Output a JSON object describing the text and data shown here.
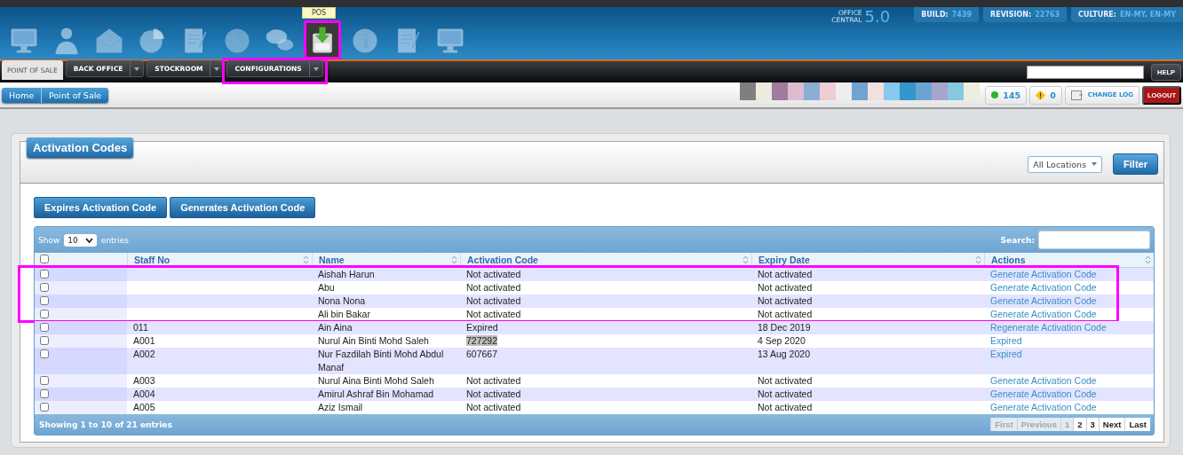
{
  "header": {
    "tooltip": "POS",
    "brand_lines": [
      "OFFICE",
      "CENTRAL"
    ],
    "version": "5.0",
    "info": [
      {
        "label": "BUILD:",
        "value": "7439"
      },
      {
        "label": "REVISION:",
        "value": "22763"
      },
      {
        "label": "CULTURE:",
        "value": "EN-MY, EN-MY"
      }
    ],
    "app_icons": [
      {
        "kind": "monitor",
        "selected": false
      },
      {
        "kind": "person",
        "selected": false
      },
      {
        "kind": "envelope",
        "selected": false
      },
      {
        "kind": "pie",
        "selected": false
      },
      {
        "kind": "document",
        "selected": false
      },
      {
        "kind": "phone",
        "selected": false
      },
      {
        "kind": "chat",
        "selected": false
      },
      {
        "kind": "pos",
        "selected": true,
        "highlighted": true
      },
      {
        "kind": "info",
        "selected": false
      },
      {
        "kind": "document",
        "selected": false
      },
      {
        "kind": "monitor",
        "selected": false
      }
    ]
  },
  "nav": {
    "tabs": [
      {
        "label": "POINT OF SALE",
        "selected": true,
        "dropdown": false,
        "highlighted": false
      },
      {
        "label": "BACK OFFICE",
        "selected": false,
        "dropdown": true,
        "highlighted": false
      },
      {
        "label": "STOCKROOM",
        "selected": false,
        "dropdown": true,
        "highlighted": false
      },
      {
        "label": "CONFIGURATIONS",
        "selected": false,
        "dropdown": true,
        "highlighted": true
      }
    ],
    "help": "HELP"
  },
  "breadcrumb": [
    "Home",
    "Point of Sale"
  ],
  "swatches": [
    {
      "color": "#7f7f7f"
    },
    {
      "color": "#ecebdc"
    },
    {
      "color": "#a07b9e"
    },
    {
      "color": "#ddbcd0"
    },
    {
      "color": "#8aafd2"
    },
    {
      "color": "#f0ccd4"
    },
    {
      "color": "#eeeeee"
    },
    {
      "color": "#6fa3d0"
    },
    {
      "color": "#f1e0de"
    },
    {
      "color": "#87c9ec"
    },
    {
      "color": "#3297cc"
    },
    {
      "color": "#6aa5d2"
    },
    {
      "color": "#a6a6cd"
    },
    {
      "color": "#86c8e0"
    },
    {
      "color": "#eeeede"
    }
  ],
  "status": {
    "online": "145",
    "warnings": "0",
    "change_log": "CHANGE LOG",
    "logout": "LOGOUT"
  },
  "panel": {
    "title": "Activation Codes",
    "location": "All Locations",
    "filter": "Filter",
    "actions": [
      "Expires Activation Code",
      "Generates Activation Code"
    ],
    "table": {
      "show_label": "Show",
      "page_size": "10",
      "entries_label": "entries",
      "search_label": "Search:",
      "select_all": false,
      "columns": [
        "Staff No",
        "Name",
        "Activation Code",
        "Expiry Date",
        "Actions"
      ],
      "rows": [
        {
          "checked": false,
          "highlighted": true,
          "staff_no": "",
          "name": "Aishah Harun",
          "code": "Not activated",
          "code_selected": false,
          "expiry": "Not activated",
          "action": "Generate Activation Code"
        },
        {
          "checked": false,
          "highlighted": true,
          "staff_no": "",
          "name": "Abu",
          "code": "Not activated",
          "code_selected": false,
          "expiry": "Not activated",
          "action": "Generate Activation Code"
        },
        {
          "checked": false,
          "highlighted": true,
          "staff_no": "",
          "name": "Nona Nona",
          "code": "Not activated",
          "code_selected": false,
          "expiry": "Not activated",
          "action": "Generate Activation Code"
        },
        {
          "checked": false,
          "highlighted": true,
          "staff_no": "",
          "name": "Ali bin Bakar",
          "code": "Not activated",
          "code_selected": false,
          "expiry": "Not activated",
          "action": "Generate Activation Code"
        },
        {
          "checked": false,
          "highlighted": false,
          "staff_no": "011",
          "name": "Ain Aina",
          "code": "Expired",
          "code_selected": false,
          "expiry": "18 Dec 2019",
          "action": "Regenerate Activation Code"
        },
        {
          "checked": false,
          "highlighted": false,
          "staff_no": "A001",
          "name": "Nurul Ain Binti Mohd Saleh",
          "code": "727292",
          "code_selected": true,
          "expiry": "4 Sep 2020",
          "action": "Expired"
        },
        {
          "checked": false,
          "highlighted": false,
          "staff_no": "A002",
          "name": "Nur Fazdilah Binti Mohd Abdul Manaf",
          "code": "607667",
          "code_selected": false,
          "expiry": "13 Aug 2020",
          "action": "Expired"
        },
        {
          "checked": false,
          "highlighted": false,
          "staff_no": "A003",
          "name": "Nurul Aina Binti Mohd Saleh",
          "code": "Not activated",
          "code_selected": false,
          "expiry": "Not activated",
          "action": "Generate Activation Code"
        },
        {
          "checked": false,
          "highlighted": false,
          "staff_no": "A004",
          "name": "Amirul Ashraf Bin Mohamad",
          "code": "Not activated",
          "code_selected": false,
          "expiry": "Not activated",
          "action": "Generate Activation Code"
        },
        {
          "checked": false,
          "highlighted": false,
          "staff_no": "A005",
          "name": "Aziz Ismail",
          "code": "Not activated",
          "code_selected": false,
          "expiry": "Not activated",
          "action": "Generate Activation Code"
        }
      ],
      "summary": "Showing 1 to 10 of 21 entries",
      "pages": [
        {
          "label": "First",
          "kind": "disabled"
        },
        {
          "label": "Previous",
          "kind": "disabled"
        },
        {
          "label": "1",
          "kind": "current"
        },
        {
          "label": "2",
          "kind": "page"
        },
        {
          "label": "3",
          "kind": "page"
        },
        {
          "label": "Next",
          "kind": "page"
        },
        {
          "label": "Last",
          "kind": "page"
        }
      ]
    }
  }
}
